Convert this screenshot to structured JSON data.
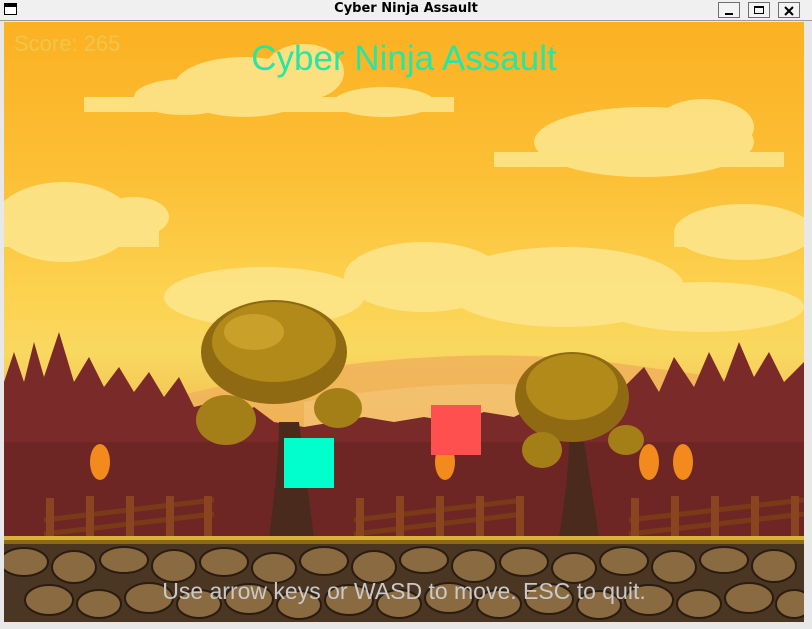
{
  "window": {
    "title": "Cyber Ninja Assault"
  },
  "hud": {
    "score_text": "Score: 265",
    "game_title": "Cyber Ninja Assault",
    "instructions": "Use arrow keys or WASD to move. ESC to quit."
  },
  "colors": {
    "player": "#00ffcc",
    "enemy": "#ff5050",
    "title_text": "#27e6a4",
    "score_text": "#f0c64a",
    "instructions_text": "#c9c9c9"
  }
}
